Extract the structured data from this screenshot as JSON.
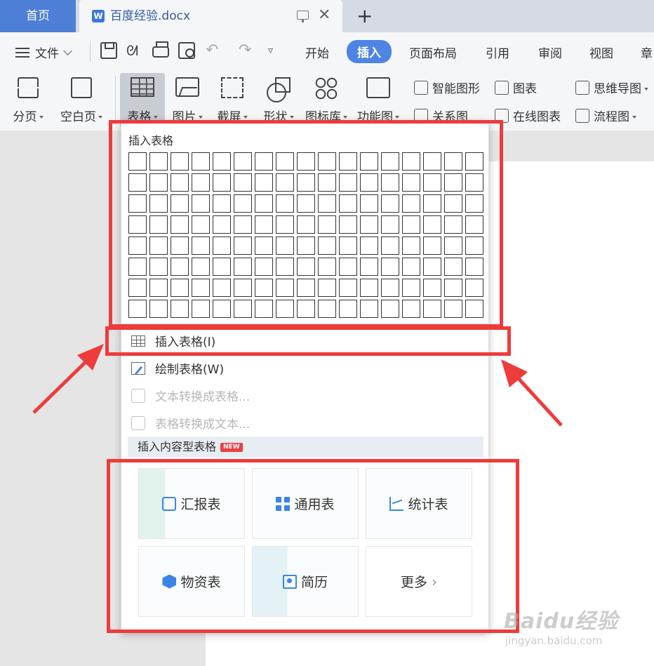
{
  "tabs": {
    "home": "首页",
    "doc_title": "百度经验.docx",
    "add": "+"
  },
  "menu": {
    "file": "文件",
    "items": [
      "开始",
      "插入",
      "页面布局",
      "引用",
      "审阅",
      "视图",
      "章"
    ],
    "active": "插入"
  },
  "ribbon": {
    "big_buttons": [
      "分页",
      "空白页",
      "表格",
      "图片",
      "截屏",
      "形状",
      "图标库",
      "功能图"
    ],
    "small_buttons": [
      "智能图形",
      "图表",
      "思维导图",
      "关系图",
      "在线图表",
      "流程图"
    ]
  },
  "dropdown": {
    "title": "插入表格",
    "grid": {
      "columns": 17,
      "rows": 8
    },
    "items": [
      {
        "label": "插入表格(I)",
        "enabled": true
      },
      {
        "label": "绘制表格(W)",
        "enabled": true
      },
      {
        "label": "文本转换成表格...",
        "enabled": false
      },
      {
        "label": "表格转换成文本...",
        "enabled": false
      }
    ],
    "section_title": "插入内容型表格",
    "new_badge": "NEW",
    "templates": [
      "汇报表",
      "通用表",
      "统计表",
      "物资表",
      "简历",
      "更多"
    ]
  },
  "watermark": {
    "brand": "Baidu经验",
    "url": "jingyan.baidu.com"
  },
  "colors": {
    "accent": "#4e84e2",
    "annotation": "#ee3b3b",
    "home_tab": "#4d7fd6"
  }
}
